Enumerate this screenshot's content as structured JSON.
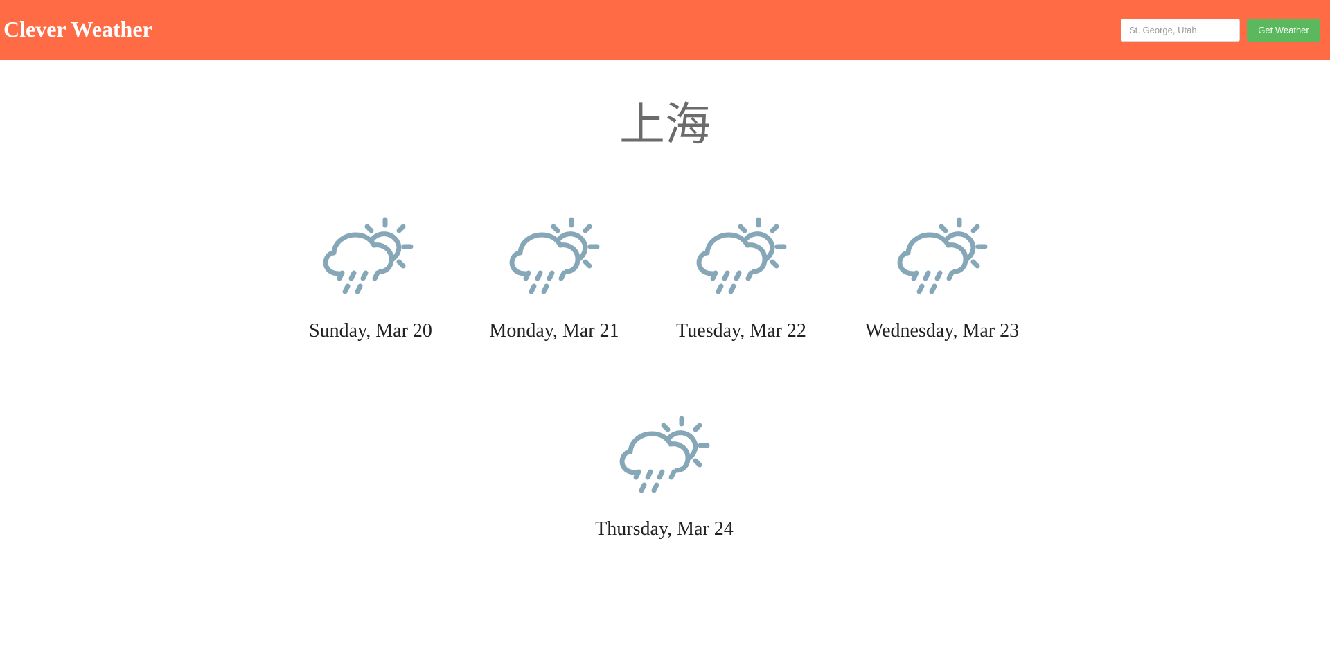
{
  "navbar": {
    "brand": "Clever Weather",
    "search_placeholder": "St. George, Utah",
    "button_label": "Get Weather",
    "background_color": "#FF6B45",
    "button_color": "#5CB85C"
  },
  "city": "上海",
  "forecast": [
    {
      "label": "Sunday, Mar 20",
      "icon": "cloud-sun-rain-icon"
    },
    {
      "label": "Monday, Mar 21",
      "icon": "cloud-sun-rain-icon"
    },
    {
      "label": "Tuesday, Mar 22",
      "icon": "cloud-sun-rain-icon"
    },
    {
      "label": "Wednesday, Mar 23",
      "icon": "cloud-sun-rain-icon"
    },
    {
      "label": "Thursday, Mar 24",
      "icon": "cloud-sun-rain-icon"
    }
  ],
  "icon_color": "#86A7B8"
}
